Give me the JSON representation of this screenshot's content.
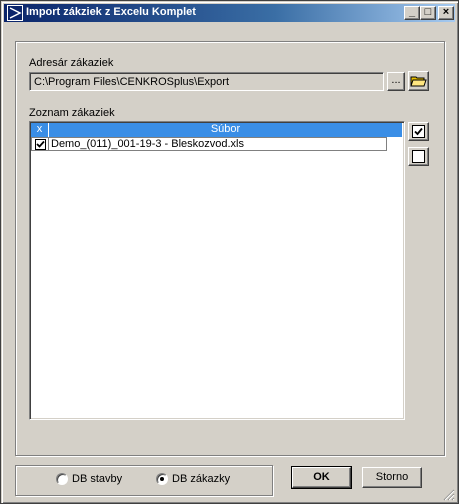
{
  "window": {
    "title": "Import zákziek z Excelu Komplet"
  },
  "title_buttons": {
    "minimize": "_",
    "maximize": "□",
    "close": "×"
  },
  "folder": {
    "label": "Adresár zákaziek",
    "path": "C:\\Program Files\\CENKROSplus\\Export",
    "browse_label": "..."
  },
  "list": {
    "label": "Zoznam zákaziek",
    "columns": [
      "x",
      "Súbor"
    ],
    "rows": [
      {
        "checked": true,
        "file": "Demo_(011)_001-19-3 - Bleskozvod.xls"
      }
    ]
  },
  "options": {
    "db_stavby": {
      "label": "DB stavby",
      "selected": false
    },
    "db_zakazky": {
      "label": "DB zákazky",
      "selected": true
    }
  },
  "buttons": {
    "ok": "OK",
    "cancel": "Storno"
  },
  "colors": {
    "title_start": "#0a246a",
    "title_end": "#a6caf0",
    "header": "#3a8ee6",
    "face": "#d4d0c8"
  }
}
